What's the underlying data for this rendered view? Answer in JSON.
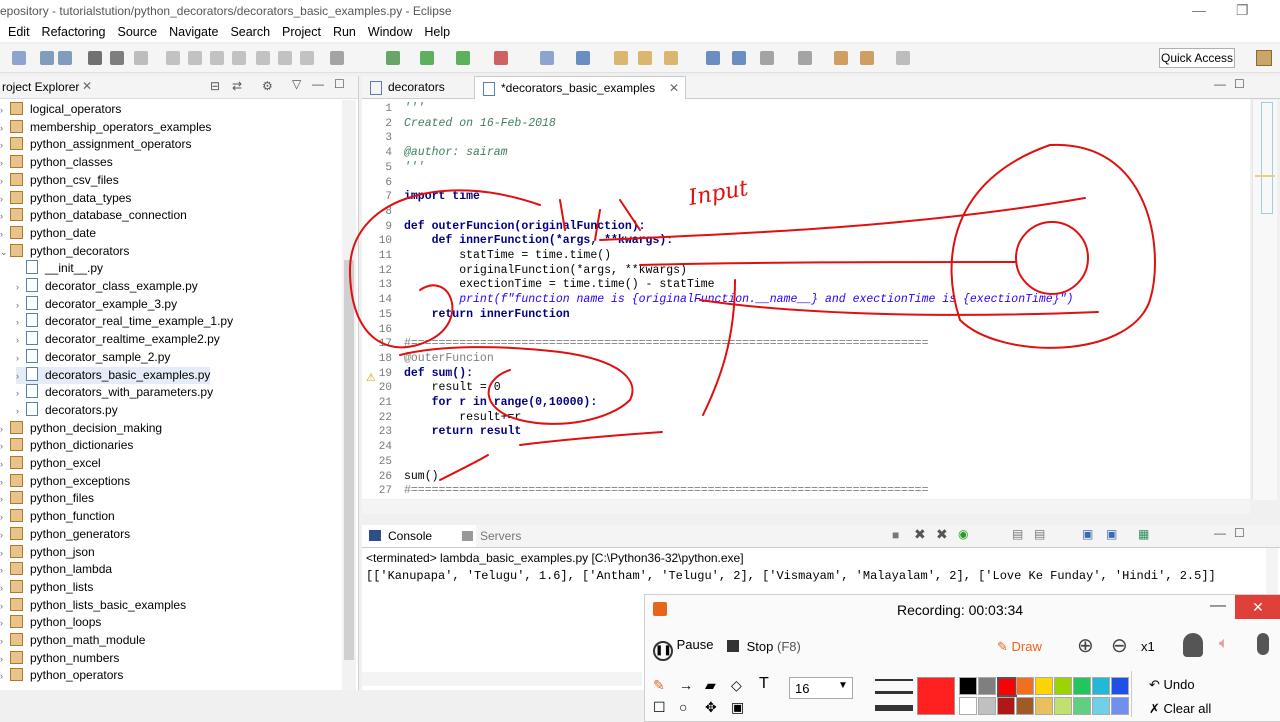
{
  "window": {
    "title": "epository - tutorialstution/python_decorators/decorators_basic_examples.py - Eclipse"
  },
  "menu": [
    "Edit",
    "Refactoring",
    "Source",
    "Navigate",
    "Search",
    "Project",
    "Run",
    "Window",
    "Help"
  ],
  "toolbar": {
    "quick_access": "Quick Access"
  },
  "explorer": {
    "title": "roject Explorer",
    "items": [
      {
        "label": "logical_operators",
        "type": "pkg",
        "indent": 0,
        "arrow": "›"
      },
      {
        "label": "membership_operators_examples",
        "type": "pkg",
        "indent": 0,
        "arrow": "›"
      },
      {
        "label": "python_assignment_operators",
        "type": "pkg",
        "indent": 0,
        "arrow": "›"
      },
      {
        "label": "python_classes",
        "type": "pkg",
        "indent": 0,
        "arrow": "›"
      },
      {
        "label": "python_csv_files",
        "type": "pkg",
        "indent": 0,
        "arrow": "›"
      },
      {
        "label": "python_data_types",
        "type": "pkg",
        "indent": 0,
        "arrow": "›"
      },
      {
        "label": "python_database_connection",
        "type": "pkg",
        "indent": 0,
        "arrow": "›"
      },
      {
        "label": "python_date",
        "type": "pkg",
        "indent": 0,
        "arrow": "›"
      },
      {
        "label": "python_decorators",
        "type": "pkg",
        "indent": 0,
        "arrow": "⌄"
      },
      {
        "label": "__init__.py",
        "type": "py",
        "indent": 1,
        "arrow": ""
      },
      {
        "label": "decorator_class_example.py",
        "type": "py",
        "indent": 1,
        "arrow": "›"
      },
      {
        "label": "decorator_example_3.py",
        "type": "py",
        "indent": 1,
        "arrow": "›"
      },
      {
        "label": "decorator_real_time_example_1.py",
        "type": "py",
        "indent": 1,
        "arrow": "›"
      },
      {
        "label": "decorator_realtime_example2.py",
        "type": "py",
        "indent": 1,
        "arrow": "›"
      },
      {
        "label": "decorator_sample_2.py",
        "type": "py",
        "indent": 1,
        "arrow": "›"
      },
      {
        "label": "decorators_basic_examples.py",
        "type": "py",
        "indent": 1,
        "arrow": "›"
      },
      {
        "label": "decorators_with_parameters.py",
        "type": "py",
        "indent": 1,
        "arrow": "›"
      },
      {
        "label": "decorators.py",
        "type": "py",
        "indent": 1,
        "arrow": "›"
      },
      {
        "label": "python_decision_making",
        "type": "pkg",
        "indent": 0,
        "arrow": "›"
      },
      {
        "label": "python_dictionaries",
        "type": "pkg",
        "indent": 0,
        "arrow": "›"
      },
      {
        "label": "python_excel",
        "type": "pkg",
        "indent": 0,
        "arrow": "›"
      },
      {
        "label": "python_exceptions",
        "type": "pkg",
        "indent": 0,
        "arrow": "›"
      },
      {
        "label": "python_files",
        "type": "pkg",
        "indent": 0,
        "arrow": "›"
      },
      {
        "label": "python_function",
        "type": "pkg",
        "indent": 0,
        "arrow": "›"
      },
      {
        "label": "python_generators",
        "type": "pkg",
        "indent": 0,
        "arrow": "›"
      },
      {
        "label": "python_json",
        "type": "pkg",
        "indent": 0,
        "arrow": "›"
      },
      {
        "label": "python_lambda",
        "type": "pkg",
        "indent": 0,
        "arrow": "›"
      },
      {
        "label": "python_lists",
        "type": "pkg",
        "indent": 0,
        "arrow": "›"
      },
      {
        "label": "python_lists_basic_examples",
        "type": "pkg",
        "indent": 0,
        "arrow": "›"
      },
      {
        "label": "python_loops",
        "type": "pkg",
        "indent": 0,
        "arrow": "›"
      },
      {
        "label": "python_math_module",
        "type": "pkg",
        "indent": 0,
        "arrow": "›"
      },
      {
        "label": "python_numbers",
        "type": "pkg",
        "indent": 0,
        "arrow": "›"
      },
      {
        "label": "python_operators",
        "type": "pkg",
        "indent": 0,
        "arrow": "›"
      }
    ]
  },
  "editor": {
    "tabs": [
      {
        "label": "decorators"
      },
      {
        "label": "*decorators_basic_examples"
      }
    ],
    "lines": [
      {
        "n": "1",
        "text": "'''"
      },
      {
        "n": "2",
        "text": "Created on 16-Feb-2018"
      },
      {
        "n": "3",
        "text": ""
      },
      {
        "n": "4",
        "text": "@author: sairam"
      },
      {
        "n": "5",
        "text": "'''"
      },
      {
        "n": "6",
        "text": ""
      },
      {
        "n": "7",
        "text": "import time"
      },
      {
        "n": "8",
        "text": ""
      },
      {
        "n": "9",
        "text": "def outerFuncion(originalFunction):"
      },
      {
        "n": "10",
        "text": "    def innerFunction(*args, **kwargs):"
      },
      {
        "n": "11",
        "text": "        statTime = time.time()"
      },
      {
        "n": "12",
        "text": "        originalFunction(*args, **kwargs)"
      },
      {
        "n": "13",
        "text": "        exectionTime = time.time() - statTime"
      },
      {
        "n": "14",
        "text": "        print(f\"function name is {originalFunction.__name__} and exectionTime is {exectionTime}\")"
      },
      {
        "n": "15",
        "text": "    return innerFunction"
      },
      {
        "n": "16",
        "text": ""
      },
      {
        "n": "17",
        "text": "#==========================================================================="
      },
      {
        "n": "18",
        "text": "@outerFuncion"
      },
      {
        "n": "19",
        "text": "def sum():"
      },
      {
        "n": "20",
        "text": "    result = 0"
      },
      {
        "n": "21",
        "text": "    for r in range(0,10000):"
      },
      {
        "n": "22",
        "text": "        result+=r"
      },
      {
        "n": "23",
        "text": "    return result"
      },
      {
        "n": "24",
        "text": ""
      },
      {
        "n": "25",
        "text": ""
      },
      {
        "n": "26",
        "text": "sum()"
      },
      {
        "n": "27",
        "text": "#==========================================================================="
      }
    ],
    "annotation": "Input"
  },
  "console": {
    "tabs": [
      {
        "label": "Console"
      },
      {
        "label": "Servers"
      }
    ],
    "status": "<terminated> lambda_basic_examples.py [C:\\Python36-32\\python.exe]",
    "output": "[['Kanupapa', 'Telugu', 1.6], ['Antham', 'Telugu', 2], ['Vismayam', 'Malayalam', 2], ['Love Ke Funday', 'Hindi', 2.5]]"
  },
  "recording": {
    "title": "Recording:",
    "time": "00:03:34",
    "pause": "Pause",
    "stop": "Stop",
    "stop_key": "(F8)",
    "draw": "Draw",
    "zoom": "x1",
    "font_size": "16",
    "undo": "Undo",
    "clear": "Clear all",
    "colors": [
      "#000000",
      "#7f7f7f",
      "#ff0000",
      "#f07020",
      "#ffd400",
      "#9bd400",
      "#22c55e",
      "#22b8d8",
      "#1e50e6",
      "#ffffff",
      "#c0c0c0",
      "#b01818",
      "#a05a28",
      "#e8c060",
      "#c0e070",
      "#60d080",
      "#70d0e8",
      "#7090f0"
    ]
  }
}
